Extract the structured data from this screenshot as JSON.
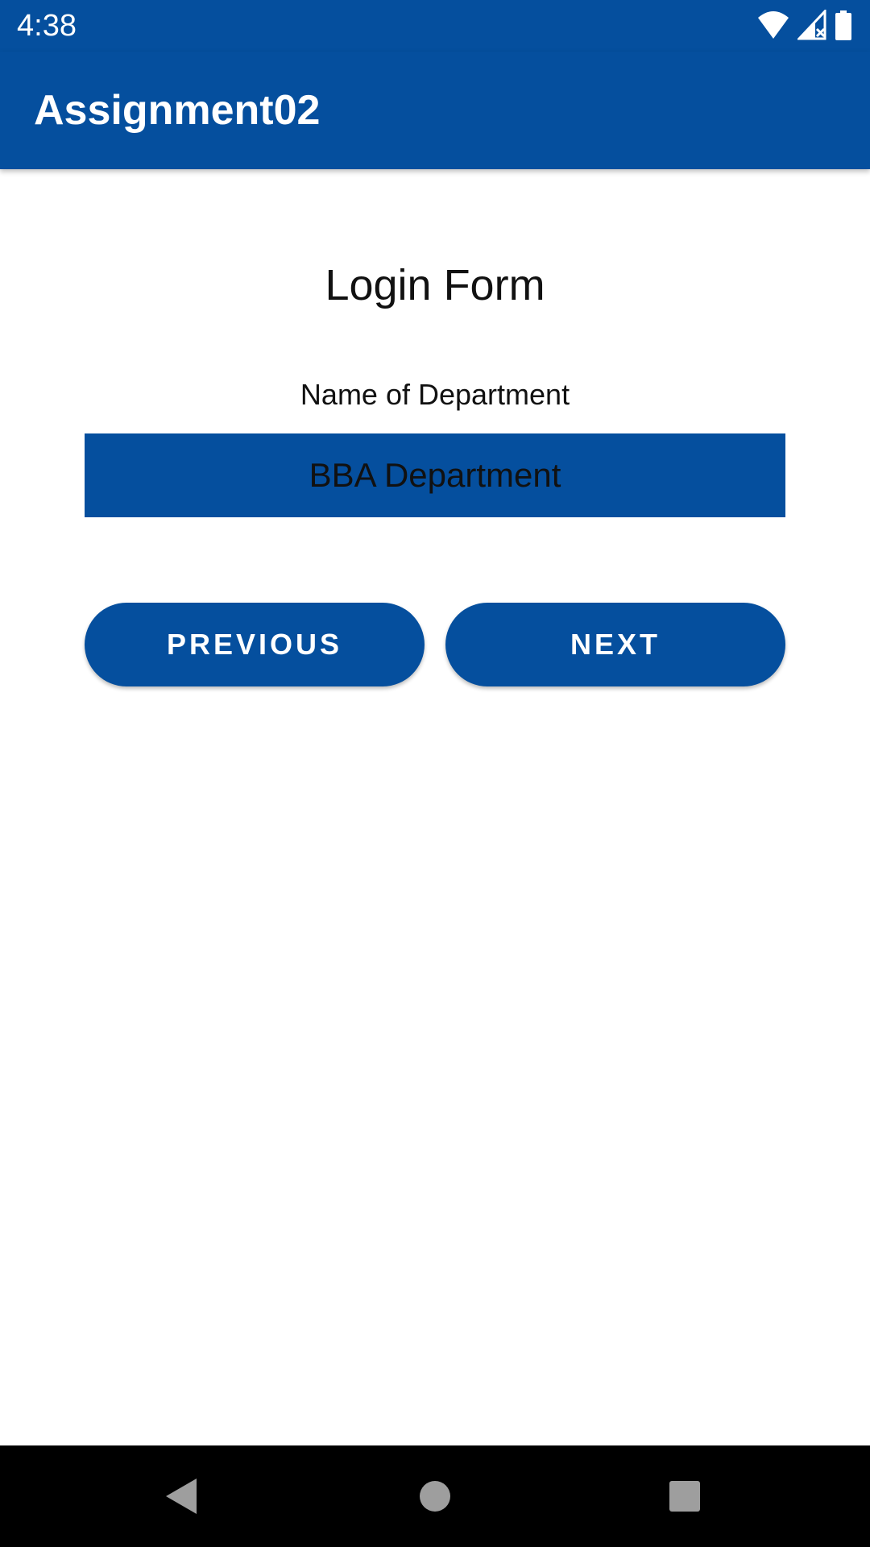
{
  "status_bar": {
    "time": "4:38",
    "icons": [
      "wifi-icon",
      "signal-icon",
      "battery-icon"
    ]
  },
  "app_bar": {
    "title": "Assignment02"
  },
  "form": {
    "title": "Login Form",
    "field_label": "Name of Department",
    "department_value": "BBA Department"
  },
  "buttons": {
    "previous_label": "PREVIOUS",
    "next_label": "NEXT"
  },
  "nav_bar": {
    "icons": [
      "back-icon",
      "home-icon",
      "recents-icon"
    ]
  },
  "colors": {
    "primary": "#054f9e",
    "nav_background": "#000000",
    "nav_icon": "#9e9e9e"
  }
}
